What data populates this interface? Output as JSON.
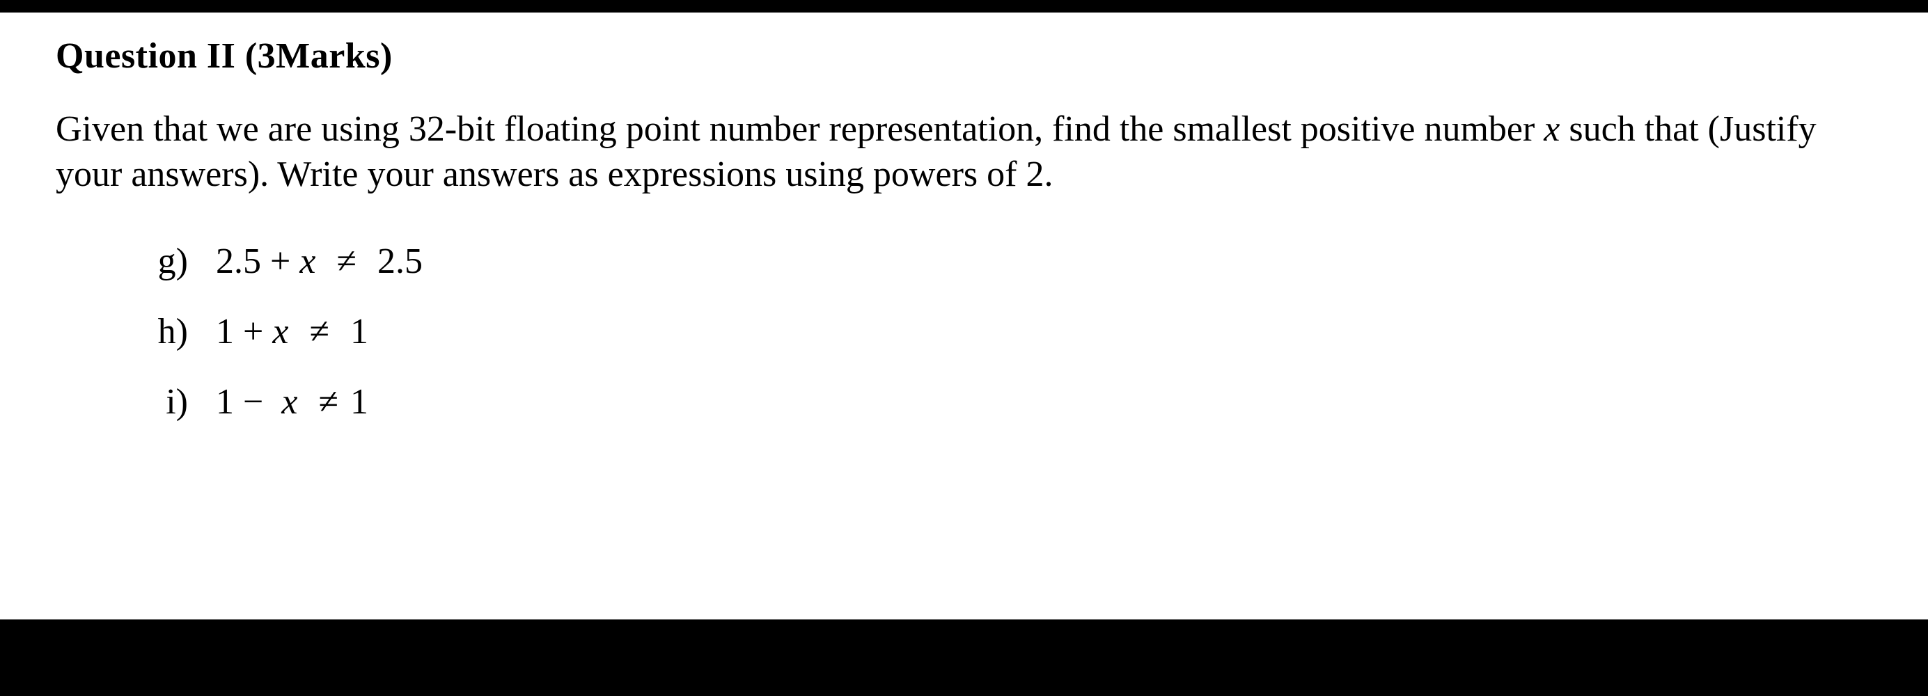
{
  "heading": "Question II (3Marks)",
  "paragraph_before_x": "Given that we are using 32-bit floating point number representation, find the smallest positive number ",
  "variable": "x",
  "paragraph_after_x": " such that (Justify your answers). Write your answers as expressions using powers of 2.",
  "items": [
    {
      "label": "g)",
      "lhs_pre": "2.5 + ",
      "var": "x",
      "rhs": "2.5"
    },
    {
      "label": "h)",
      "lhs_pre": "1 + ",
      "var": "x",
      "rhs": "1"
    },
    {
      "label": "i)",
      "lhs_pre": "1 − ",
      "var": "x",
      "rhs": "1"
    }
  ],
  "neq_symbol": "≠"
}
